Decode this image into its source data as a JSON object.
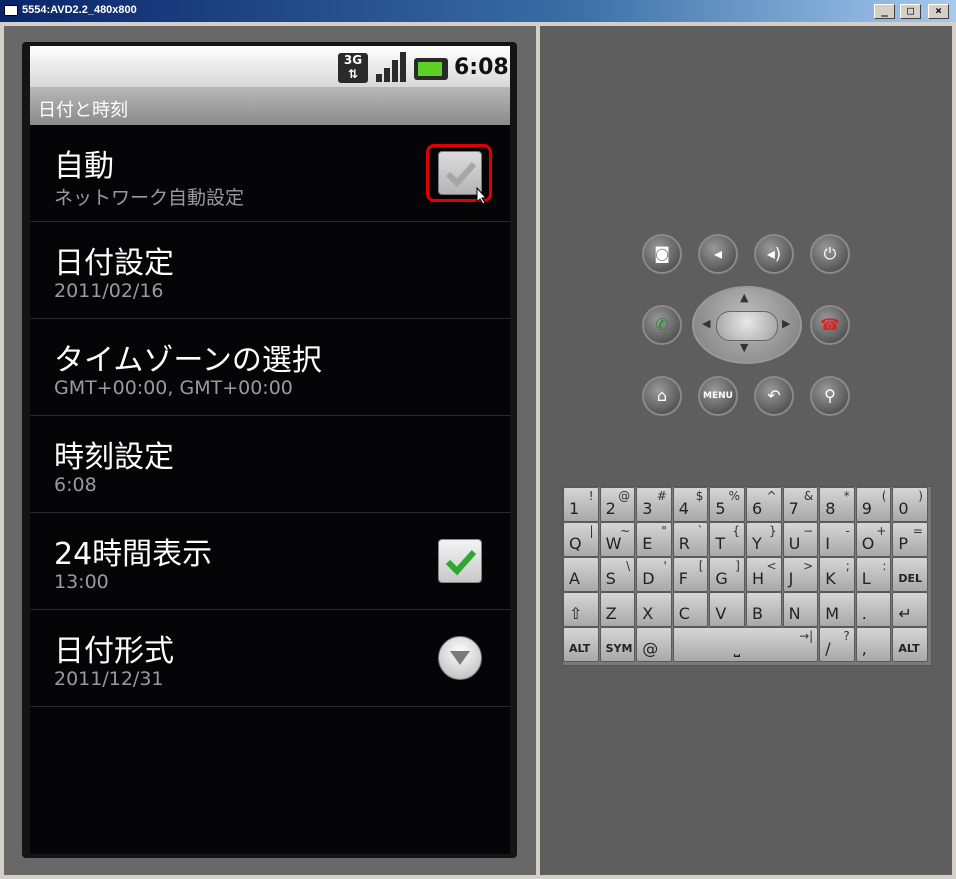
{
  "window": {
    "title": "5554:AVD2.2_480x800",
    "minimize": "_",
    "maximize": "□",
    "close": "×"
  },
  "status_bar": {
    "network": "3G",
    "time": "6:08"
  },
  "screen_title": "日付と時刻",
  "settings": [
    {
      "title": "自動",
      "summary": "ネットワーク自動設定",
      "control": "checkbox",
      "checked": true,
      "highlighted": true
    },
    {
      "title": "日付設定",
      "summary": "2011/02/16"
    },
    {
      "title": "タイムゾーンの選択",
      "summary": "GMT+00:00, GMT+00:00"
    },
    {
      "title": "時刻設定",
      "summary": "6:08"
    },
    {
      "title": "24時間表示",
      "summary": "13:00",
      "control": "checkbox",
      "checked": true
    },
    {
      "title": "日付形式",
      "summary": "2011/12/31",
      "control": "dropdown"
    }
  ],
  "hardware": {
    "menu_label": "MENU"
  },
  "keyboard": {
    "rows": [
      [
        [
          "1",
          "!"
        ],
        [
          "2",
          "@"
        ],
        [
          "3",
          "#"
        ],
        [
          "4",
          "$"
        ],
        [
          "5",
          "%"
        ],
        [
          "6",
          "^"
        ],
        [
          "7",
          "&"
        ],
        [
          "8",
          "*"
        ],
        [
          "9",
          "("
        ],
        [
          "0",
          ")"
        ]
      ],
      [
        [
          "Q",
          "|"
        ],
        [
          "W",
          "~"
        ],
        [
          "E",
          "\""
        ],
        [
          "R",
          "`"
        ],
        [
          "T",
          "{"
        ],
        [
          "Y",
          "}"
        ],
        [
          "U",
          "−"
        ],
        [
          "I",
          "-"
        ],
        [
          "O",
          "+"
        ],
        [
          "P",
          "="
        ]
      ],
      [
        [
          "A",
          ""
        ],
        [
          "S",
          "\\"
        ],
        [
          "D",
          "'"
        ],
        [
          "F",
          "["
        ],
        [
          "G",
          "]"
        ],
        [
          "H",
          "<"
        ],
        [
          "J",
          ">"
        ],
        [
          "K",
          ";"
        ],
        [
          "L",
          ":"
        ],
        [
          "DEL",
          ""
        ]
      ],
      [
        [
          "⇧",
          ""
        ],
        [
          "Z",
          ""
        ],
        [
          "X",
          ""
        ],
        [
          "C",
          ""
        ],
        [
          "V",
          ""
        ],
        [
          "B",
          ""
        ],
        [
          "N",
          ""
        ],
        [
          "M",
          ""
        ],
        [
          ".",
          ""
        ],
        [
          "↵",
          ""
        ]
      ],
      [
        [
          "ALT",
          ""
        ],
        [
          "SYM",
          ""
        ],
        [
          "@",
          ""
        ],
        [
          "⎵",
          "→|"
        ],
        [
          "/",
          "?"
        ],
        [
          ",",
          ""
        ],
        [
          "ALT",
          ""
        ]
      ]
    ]
  },
  "colors": {
    "highlight": "#e00000",
    "check_green": "#2ea82e"
  }
}
